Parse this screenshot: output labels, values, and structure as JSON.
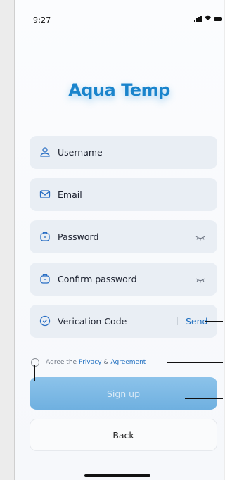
{
  "status_bar": {
    "time": "9:27"
  },
  "app": {
    "title": "Aqua Temp"
  },
  "form": {
    "username": {
      "placeholder": "Username",
      "icon": "user-icon"
    },
    "email": {
      "placeholder": "Email",
      "icon": "mail-icon"
    },
    "password": {
      "placeholder": "Password",
      "icon": "lock-icon",
      "toggle_icon": "eye-closed-icon"
    },
    "confirm_password": {
      "placeholder": "Confirm password",
      "icon": "lock-icon",
      "toggle_icon": "eye-closed-icon"
    },
    "verification": {
      "placeholder": "Verication Code",
      "icon": "shield-icon",
      "send_label": "Send"
    }
  },
  "agreement": {
    "prefix": "Agree the",
    "privacy_link": "Privacy",
    "joiner": "&",
    "agreement_link": "Agreement"
  },
  "buttons": {
    "signup_label": "Sign up",
    "back_label": "Back"
  },
  "colors": {
    "accent": "#1a84cc",
    "link": "#1f6fc0",
    "field_bg": "#e9eef4",
    "signup_bg": "#7ab8e5"
  }
}
